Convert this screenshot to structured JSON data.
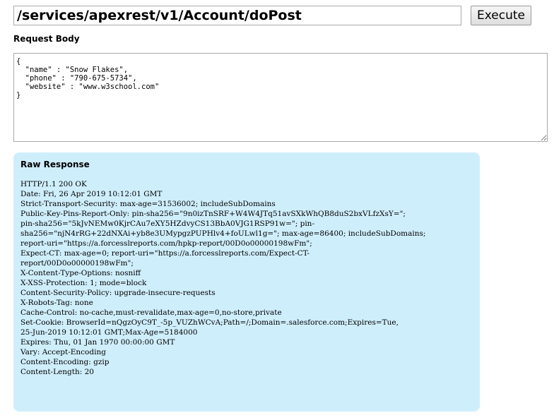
{
  "url_bar": {
    "value": "/services/apexrest/v1/Account/doPost"
  },
  "execute_button": {
    "label": "Execute"
  },
  "request_body": {
    "label": "Request Body",
    "value": "{\n  \"name\" : \"Snow Flakes\",\n  \"phone\" : \"790-675-5734\",\n  \"website\" : \"www.w3school.com\"\n}"
  },
  "raw_response": {
    "title": "Raw Response",
    "lines": [
      "HTTP/1.1 200 OK",
      "Date: Fri, 26 Apr 2019 10:12:01 GMT",
      "Strict-Transport-Security: max-age=31536002; includeSubDomains",
      "Public-Key-Pins-Report-Only: pin-sha256=\"9n0izTnSRF+W4W4JTq51avSXkWhQB8duS2bxVLfzXsY=\";",
      "pin-sha256=\"5kJvNEMw0KjrCAu7eXY5HZdvyCS13BbA0VJG1RSP91w=\"; pin-",
      "sha256=\"njN4rRG+22dNXAi+yb8e3UMypgzPUPHlv4+foULwl1g=\"; max-age=86400; includeSubDomains;",
      "report-uri=\"https://a.forcesslreports.com/hpkp-report/00D0o00000198wFm\";",
      "Expect-CT: max-age=0; report-uri=\"https://a.forcesslreports.com/Expect-CT-",
      "report/00D0o00000198wFm\";",
      "X-Content-Type-Options: nosniff",
      "X-XSS-Protection: 1; mode=block",
      "Content-Security-Policy: upgrade-insecure-requests",
      "X-Robots-Tag: none",
      "Cache-Control: no-cache,must-revalidate,max-age=0,no-store,private",
      "Set-Cookie: BrowserId=nQgzOyC9T_-5p_VUZhWCvA;Path=/;Domain=.salesforce.com;Expires=Tue,",
      "25-Jun-2019 10:12:01 GMT;Max-Age=5184000",
      "Expires: Thu, 01 Jan 1970 00:00:00 GMT",
      "Vary: Accept-Encoding",
      "Content-Encoding: gzip",
      "Content-Length: 20"
    ]
  },
  "colors": {
    "response_panel_bg": "#cfeefc"
  }
}
